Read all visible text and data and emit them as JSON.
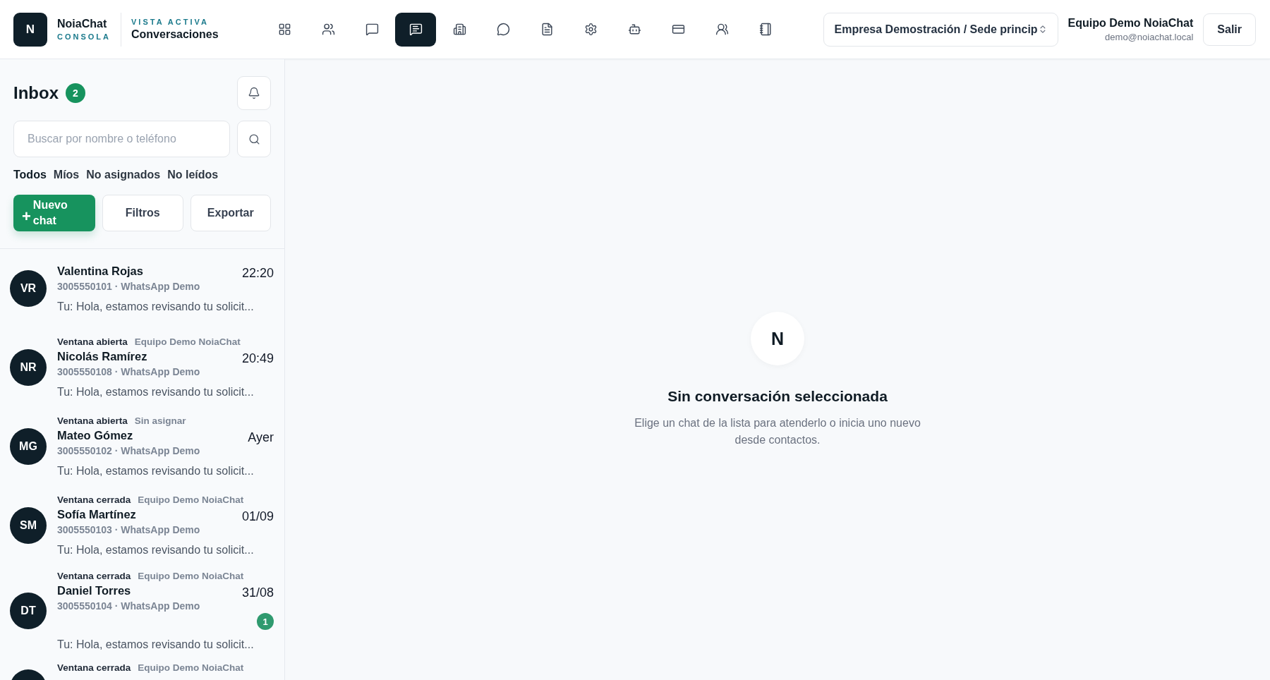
{
  "brand": {
    "logo": "N",
    "name": "NoiaChat",
    "subtitle": "CONSOLA"
  },
  "view": {
    "label": "VISTA ACTIVA",
    "title": "Conversaciones"
  },
  "nav_items": [
    {
      "selected": false
    },
    {
      "selected": false
    },
    {
      "selected": false
    },
    {
      "selected": true
    },
    {
      "selected": false
    },
    {
      "selected": false
    },
    {
      "selected": false
    },
    {
      "selected": false
    },
    {
      "selected": false
    },
    {
      "selected": false
    },
    {
      "selected": false
    },
    {
      "selected": false
    }
  ],
  "company_select": {
    "value": "Empresa Demostración / Sede princip"
  },
  "user": {
    "name": "Equipo Demo NoiaChat",
    "email": "demo@noiachat.local"
  },
  "logout_button": "Salir",
  "inbox": {
    "title": "Inbox",
    "count": "2",
    "search": {
      "placeholder": "Buscar por nombre o teléfono"
    },
    "filters": [
      {
        "label": "Todos",
        "selected": true
      },
      {
        "label": "Míos",
        "selected": false
      },
      {
        "label": "No asignados",
        "selected": false
      },
      {
        "label": "No leídos",
        "selected": false
      }
    ],
    "new_chat_button": {
      "icon": "+",
      "label": "Nuevo chat"
    },
    "buttons": [
      "Filtros",
      "Exportar"
    ],
    "conversations": [
      {
        "initials": "VR",
        "name": "Valentina Rojas",
        "time": "22:20",
        "contact": "3005550101 · WhatsApp Demo",
        "preview": "Tu: Hola, estamos revisando tu solicit..."
      },
      {
        "status": "Ventana abierta",
        "agent": "Equipo Demo NoiaChat",
        "initials": "NR",
        "name": "Nicolás Ramírez",
        "time": "20:49",
        "contact": "3005550108 · WhatsApp Demo",
        "preview": "Tu: Hola, estamos revisando tu solicit..."
      },
      {
        "status": "Ventana abierta",
        "agent": "Sin asignar",
        "initials": "MG",
        "name": "Mateo Gómez",
        "time": "Ayer",
        "contact": "3005550102 · WhatsApp Demo",
        "preview": "Tu: Hola, estamos revisando tu solicit..."
      },
      {
        "status": "Ventana cerrada",
        "agent": "Equipo Demo NoiaChat",
        "initials": "SM",
        "name": "Sofía Martínez",
        "time": "01/09",
        "contact": "3005550103 · WhatsApp Demo",
        "preview": "Tu: Hola, estamos revisando tu solicit..."
      },
      {
        "status": "Ventana cerrada",
        "agent": "Equipo Demo NoiaChat",
        "initials": "DT",
        "name": "Daniel Torres",
        "time": "31/08",
        "contact": "3005550104 · WhatsApp Demo",
        "unread": "1",
        "preview": "Tu: Hola, estamos revisando tu solicit..."
      },
      {
        "status": "Ventana cerrada",
        "agent": "Equipo Demo NoiaChat"
      }
    ]
  },
  "empty_state": {
    "logo": "N",
    "title": "Sin conversación seleccionada",
    "text": "Elige un chat de la lista para atenderlo o inicia uno nuevo desde contactos."
  }
}
